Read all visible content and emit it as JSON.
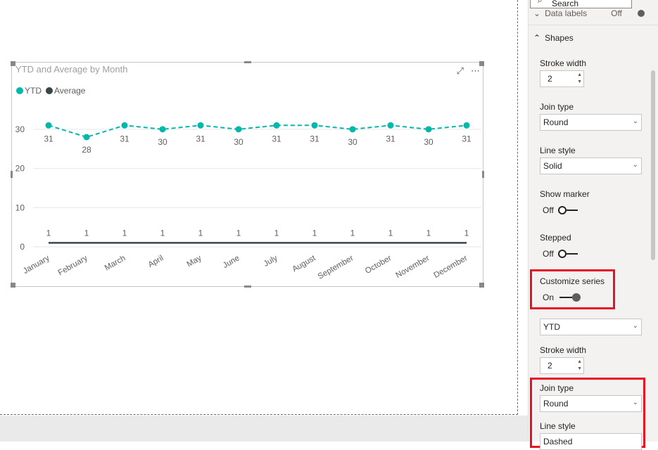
{
  "visual": {
    "title": "YTD and Average by Month",
    "focus_icon": "focus-mode-icon",
    "more_icon": "more-options-icon",
    "legend": [
      {
        "label": "YTD",
        "color": "#01b8aa"
      },
      {
        "label": "Average",
        "color": "#374649"
      }
    ]
  },
  "chart_data": {
    "type": "line",
    "categories": [
      "January",
      "February",
      "March",
      "April",
      "May",
      "June",
      "July",
      "August",
      "September",
      "October",
      "November",
      "December"
    ],
    "series": [
      {
        "name": "YTD",
        "values": [
          31,
          28,
          31,
          30,
          31,
          30,
          31,
          31,
          30,
          31,
          30,
          31
        ],
        "color": "#01b8aa",
        "style": "dashed",
        "markers": true
      },
      {
        "name": "Average",
        "values": [
          1,
          1,
          1,
          1,
          1,
          1,
          1,
          1,
          1,
          1,
          1,
          1
        ],
        "color": "#374649",
        "style": "solid",
        "markers": false
      }
    ],
    "title": "YTD and Average by Month",
    "xlabel": "",
    "ylabel": "",
    "y_ticks": [
      0,
      10,
      20,
      30
    ],
    "ylim": [
      0,
      35
    ],
    "grid": true,
    "legend_position": "top-left",
    "data_labels": true
  },
  "panel": {
    "search_placeholder": "Search",
    "data_labels": {
      "label": "Data labels",
      "state": "Off"
    },
    "shapes_header": "Shapes",
    "stroke_width_label": "Stroke width",
    "stroke_width_value": "2",
    "join_type_label": "Join type",
    "join_type_value": "Round",
    "line_style_label": "Line style",
    "line_style_value": "Solid",
    "show_marker_label": "Show marker",
    "show_marker_state": "Off",
    "stepped_label": "Stepped",
    "stepped_state": "Off",
    "customize_series_label": "Customize series",
    "customize_series_state": "On",
    "series_select_value": "YTD",
    "series_stroke_width_label": "Stroke width",
    "series_stroke_width_value": "2",
    "series_join_type_label": "Join type",
    "series_join_type_value": "Round",
    "series_line_style_label": "Line style",
    "series_line_style_value": "Dashed"
  },
  "colors": {
    "highlight": "#e81123",
    "accent": "#01b8aa"
  }
}
